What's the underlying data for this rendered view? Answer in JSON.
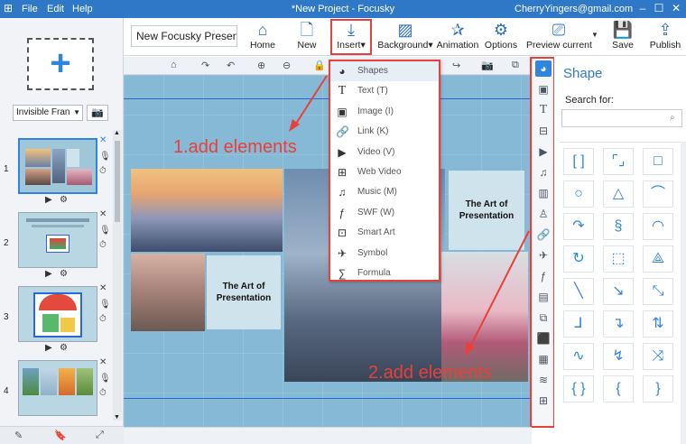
{
  "titlebar": {
    "menus": [
      "File",
      "Edit",
      "Help"
    ],
    "title": "*New Project - Focusky",
    "account": "CherryYingers@gmail.com",
    "controls": [
      "minimize-icon",
      "maximize-icon",
      "close-icon"
    ]
  },
  "left": {
    "frame_select": "Invisible Fran",
    "thumbnails": [
      {
        "num": "1"
      },
      {
        "num": "2"
      },
      {
        "num": "3"
      },
      {
        "num": "4"
      }
    ]
  },
  "toolbar": {
    "project_name": "New Focusky Presenta",
    "home": "Home",
    "new": "New",
    "insert": "Insert",
    "background": "Background",
    "animation": "Animation",
    "options": "Options",
    "preview": "Preview current",
    "save": "Save",
    "publish": "Publish"
  },
  "canvas": {
    "card1": "The Art of Presentation",
    "card2": "The Art of Presentation"
  },
  "insert_menu": {
    "items": [
      {
        "icon": "shapes-icon",
        "label": "Shapes"
      },
      {
        "icon": "text-icon",
        "label": "Text (T)"
      },
      {
        "icon": "image-icon",
        "label": "Image (I)"
      },
      {
        "icon": "link-icon",
        "label": "Link (K)"
      },
      {
        "icon": "video-icon",
        "label": "Video (V)"
      },
      {
        "icon": "web-video-icon",
        "label": "Web Video"
      },
      {
        "icon": "music-icon",
        "label": "Music (M)"
      },
      {
        "icon": "swf-icon",
        "label": "SWF (W)"
      },
      {
        "icon": "smart-art-icon",
        "label": "Smart Art"
      },
      {
        "icon": "symbol-icon",
        "label": "Symbol"
      },
      {
        "icon": "formula-icon",
        "label": "Formula"
      }
    ]
  },
  "annotations": {
    "first": "1.add elements",
    "second": "2.add elements"
  },
  "shape_panel": {
    "title": "Shape",
    "search_label": "Search for:",
    "search_value": ""
  },
  "colors": {
    "accent": "#2f86de",
    "titlebar": "#2f78c8",
    "annotation": "#e8403a"
  }
}
